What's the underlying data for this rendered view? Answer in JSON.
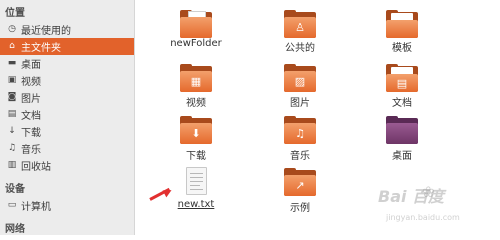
{
  "sidebar": {
    "places_title": "位置",
    "places": [
      {
        "label": "最近使用的",
        "icon": "clock-icon",
        "glyph": "◷"
      },
      {
        "label": "主文件夹",
        "icon": "home-icon",
        "glyph": "⌂",
        "active": true
      },
      {
        "label": "桌面",
        "icon": "desktop-icon",
        "glyph": "▬"
      },
      {
        "label": "视频",
        "icon": "video-icon",
        "glyph": "▣"
      },
      {
        "label": "图片",
        "icon": "camera-icon",
        "glyph": "◙"
      },
      {
        "label": "文档",
        "icon": "document-icon",
        "glyph": "▤"
      },
      {
        "label": "下载",
        "icon": "download-icon",
        "glyph": "↓"
      },
      {
        "label": "音乐",
        "icon": "music-icon",
        "glyph": "♫"
      },
      {
        "label": "回收站",
        "icon": "trash-icon",
        "glyph": "▥"
      }
    ],
    "devices_title": "设备",
    "devices": [
      {
        "label": "计算机",
        "icon": "computer-icon",
        "glyph": "▭"
      }
    ],
    "network_title": "网络"
  },
  "files": [
    {
      "name": "newFolder",
      "icon": "folder-icon",
      "glyph": ""
    },
    {
      "name": "公共的",
      "icon": "public-folder-icon",
      "glyph": "♙"
    },
    {
      "name": "模板",
      "icon": "templates-folder-icon",
      "glyph": ""
    },
    {
      "name": "视频",
      "icon": "videos-folder-icon",
      "glyph": "▦"
    },
    {
      "name": "图片",
      "icon": "pictures-folder-icon",
      "glyph": "▨"
    },
    {
      "name": "文档",
      "icon": "documents-folder-icon",
      "glyph": "▤"
    },
    {
      "name": "下载",
      "icon": "downloads-folder-icon",
      "glyph": "⬇"
    },
    {
      "name": "音乐",
      "icon": "music-folder-icon",
      "glyph": "♫"
    },
    {
      "name": "桌面",
      "icon": "desktop-folder-icon",
      "glyph": ""
    },
    {
      "name": "new.txt",
      "icon": "text-file-icon",
      "glyph": ""
    },
    {
      "name": "示例",
      "icon": "examples-folder-icon",
      "glyph": "↗"
    }
  ],
  "colors": {
    "accent": "#e2622b",
    "folder": "#e5692c",
    "desktop_folder": "#7b3f73",
    "annotation_arrow": "#e23030"
  },
  "watermark": {
    "main": "Bai  百度",
    "paw": "❀",
    "sub": "jingyan.baidu.com"
  }
}
